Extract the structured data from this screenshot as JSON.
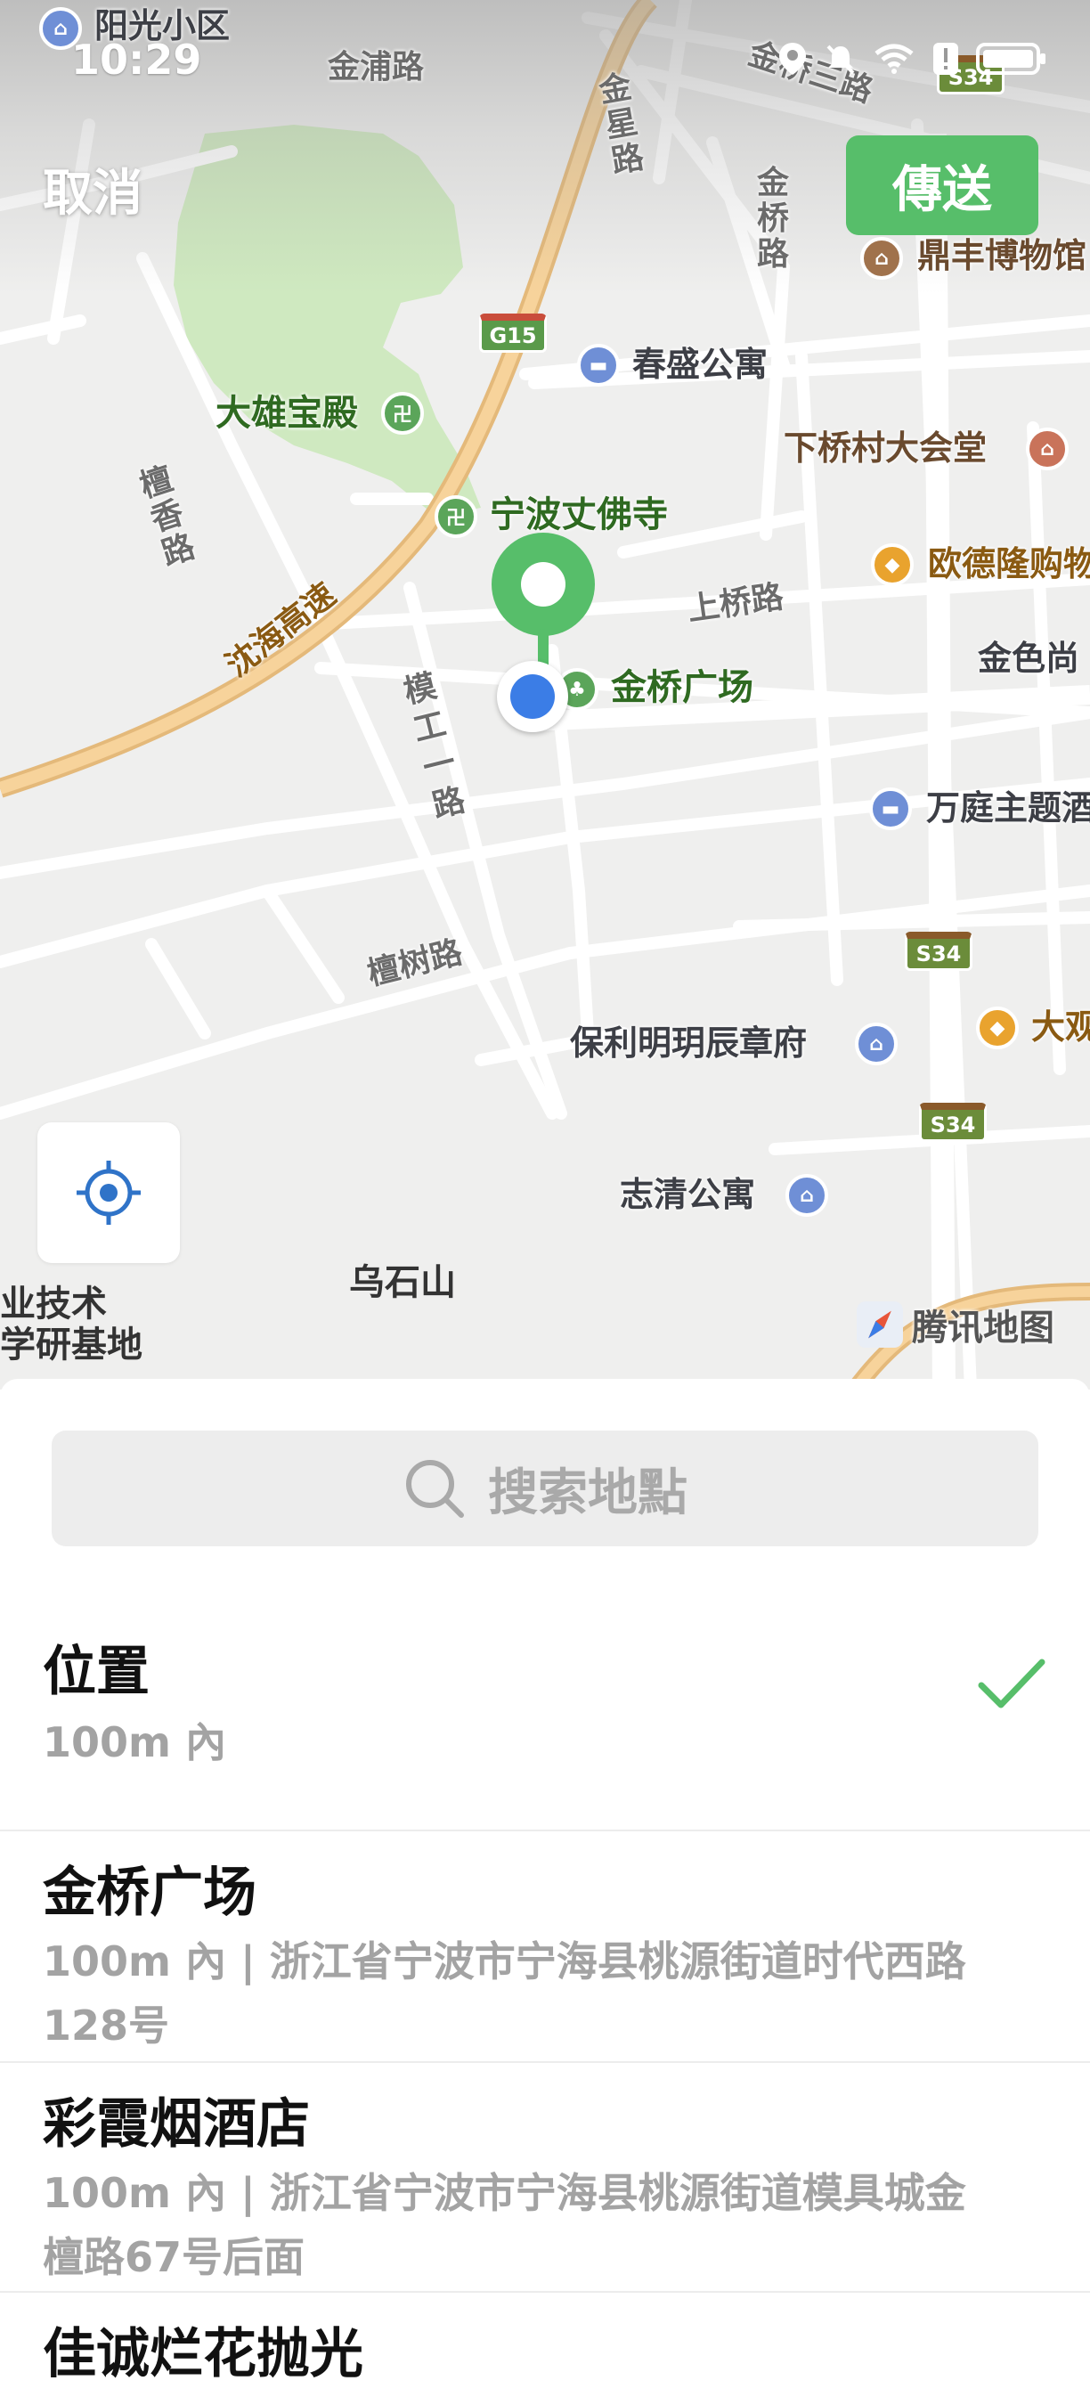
{
  "status_bar": {
    "time": "10:29",
    "icons": [
      "location-icon",
      "mute-icon",
      "wifi-icon",
      "alert-icon",
      "battery-icon"
    ]
  },
  "header": {
    "cancel_label": "取消",
    "send_label": "傳送"
  },
  "map": {
    "roads": [
      "金浦路",
      "金桥三路",
      "金星路",
      "金桥路",
      "檀香路",
      "沈海高速",
      "上桥路",
      "模工一路",
      "檀树路"
    ],
    "highway_shields": [
      "G15",
      "S34",
      "S34",
      "S34"
    ],
    "pois": [
      {
        "name": "阳光小区",
        "icon": "home-icon"
      },
      {
        "name": "鼎丰博物馆",
        "icon": "museum-icon"
      },
      {
        "name": "春盛公寓",
        "icon": "hotel-icon"
      },
      {
        "name": "大雄宝殿",
        "icon": "temple-icon"
      },
      {
        "name": "下桥村大会堂",
        "icon": "hall-icon"
      },
      {
        "name": "宁波丈佛寺",
        "icon": "temple-icon"
      },
      {
        "name": "欧德隆购物",
        "icon": "shopping-icon"
      },
      {
        "name": "金桥广场",
        "icon": "park-icon"
      },
      {
        "name": "金色尚",
        "icon": ""
      },
      {
        "name": "万庭主题酒",
        "icon": "hotel-icon"
      },
      {
        "name": "保利明玥辰章府",
        "icon": "home-icon"
      },
      {
        "name": "大观",
        "icon": "shopping-icon"
      },
      {
        "name": "志清公寓",
        "icon": "home-icon"
      },
      {
        "name": "乌石山",
        "icon": ""
      },
      {
        "name": "业技术",
        "icon": ""
      },
      {
        "name": "学研基地",
        "icon": ""
      }
    ],
    "attribution": "腾讯地图"
  },
  "search": {
    "placeholder": "搜索地點"
  },
  "results": [
    {
      "title": "位置",
      "subtitle": "100m 內",
      "selected": true
    },
    {
      "title": "金桥广场",
      "subtitle": "100m 內 | 浙江省宁波市宁海县桃源街道时代西路128号",
      "selected": false
    },
    {
      "title": "彩霞烟酒店",
      "subtitle": "100m 內 | 浙江省宁波市宁海县桃源街道模具城金檀路67号后面",
      "selected": false
    },
    {
      "title": "佳诚烂花抛光",
      "subtitle": "",
      "selected": false
    }
  ],
  "colors": {
    "accent": "#57be6a",
    "user_dot": "#3b7de6",
    "highway": "#f2c27a"
  }
}
